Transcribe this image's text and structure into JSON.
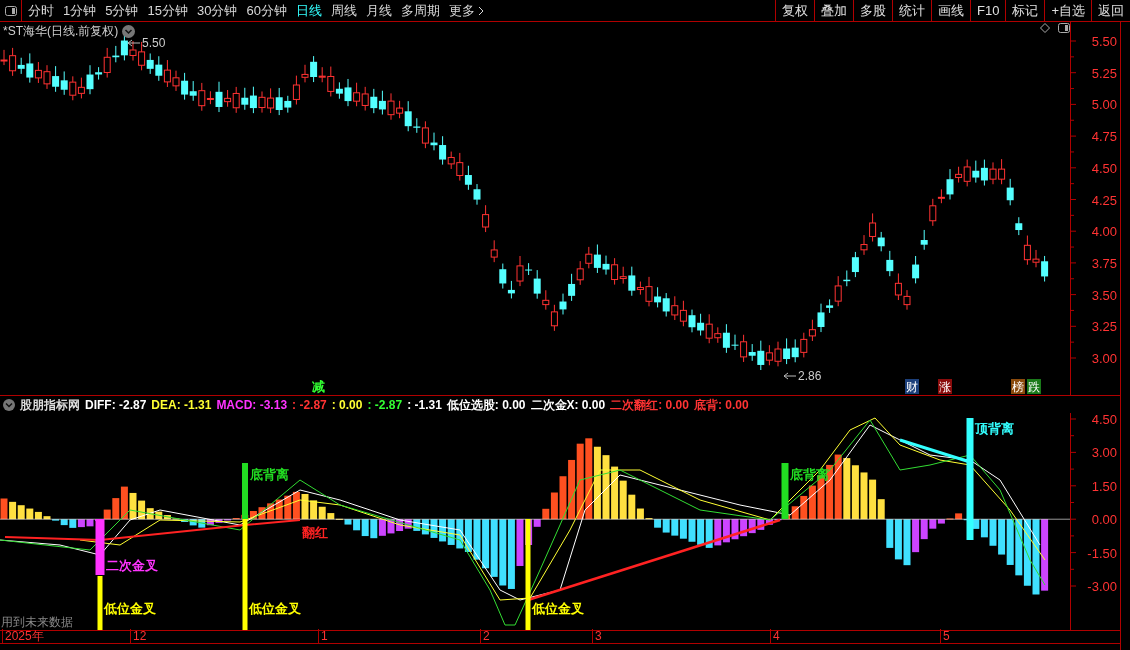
{
  "toolbar": {
    "periods": [
      {
        "label": "分时",
        "selected": false
      },
      {
        "label": "1分钟",
        "selected": false
      },
      {
        "label": "5分钟",
        "selected": false
      },
      {
        "label": "15分钟",
        "selected": false
      },
      {
        "label": "30分钟",
        "selected": false
      },
      {
        "label": "60分钟",
        "selected": false
      },
      {
        "label": "日线",
        "selected": true
      },
      {
        "label": "周线",
        "selected": false
      },
      {
        "label": "月线",
        "selected": false
      },
      {
        "label": "多周期",
        "selected": false
      },
      {
        "label": "更多",
        "selected": false
      }
    ],
    "buttons": [
      "复权",
      "叠加",
      "多股",
      "统计",
      "画线",
      "F10",
      "标记",
      "+自选",
      "返回"
    ]
  },
  "price_panel": {
    "title": "*ST海华(日线.前复权)",
    "high_label": "5.50",
    "low_label": "2.86",
    "ticks": [
      "5.50",
      "5.25",
      "5.00",
      "4.75",
      "4.50",
      "4.25",
      "4.00",
      "3.75",
      "3.50",
      "3.25",
      "3.00"
    ],
    "markers": [
      {
        "text": "减",
        "color": "#33ff33"
      },
      {
        "text": "财",
        "color": "#1c3f7a"
      },
      {
        "text": "涨",
        "color": "#8a0c0c"
      },
      {
        "text": "榜",
        "color": "#8a4a0c"
      },
      {
        "text": "跌",
        "color": "#1a7a1a"
      }
    ]
  },
  "indicator_panel": {
    "legend": [
      {
        "text": "股朋指标网",
        "color": "#dddddd"
      },
      {
        "text": "DIFF: -2.87",
        "color": "#ffffff"
      },
      {
        "text": "DEA: -1.31",
        "color": "#ffff33"
      },
      {
        "text": "MACD: -3.13",
        "color": "#ff33ff"
      },
      {
        "text": ": -2.87",
        "color": "#ff3333"
      },
      {
        "text": ": 0.00",
        "color": "#ffff33"
      },
      {
        "text": ": -2.87",
        "color": "#33ff33"
      },
      {
        "text": ": -1.31",
        "color": "#ffffff"
      },
      {
        "text": "低位选股: 0.00",
        "color": "#ffffff"
      },
      {
        "text": "二次金X: 0.00",
        "color": "#ffffff"
      },
      {
        "text": "二次翻红: 0.00",
        "color": "#ff3333"
      },
      {
        "text": "底背: 0.00",
        "color": "#ff3333"
      }
    ],
    "ticks": [
      "4.50",
      "3.00",
      "1.50",
      "0.00",
      "-1.50",
      "-3.00"
    ],
    "signals": [
      {
        "text": "低位金叉",
        "color": "#ffff00"
      },
      {
        "text": "二次金叉",
        "color": "#ff33ff"
      },
      {
        "text": "低位金叉",
        "color": "#ffff00"
      },
      {
        "text": "底背离",
        "color": "#22dd22"
      },
      {
        "text": "翻红",
        "color": "#ff2222"
      },
      {
        "text": "低位金叉",
        "color": "#ffff00"
      },
      {
        "text": "底背离",
        "color": "#22dd22"
      },
      {
        "text": "顶背离",
        "color": "#33ffff"
      }
    ],
    "note": "用到未来数据"
  },
  "date_axis": [
    "2025年",
    "12",
    "1",
    "2",
    "3",
    "4",
    "5"
  ]
}
